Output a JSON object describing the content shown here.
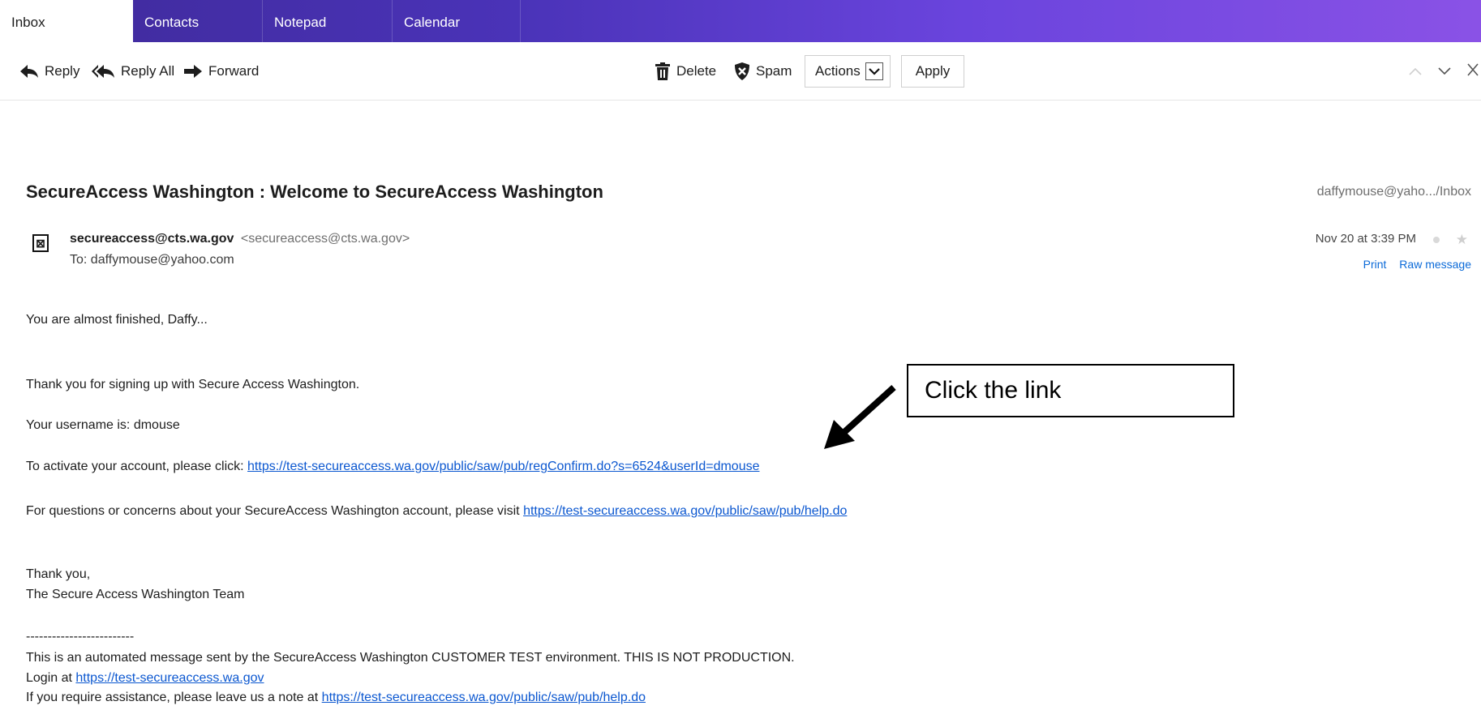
{
  "tabs": [
    {
      "label": "Inbox",
      "active": true
    },
    {
      "label": "Contacts",
      "active": false
    },
    {
      "label": "Notepad",
      "active": false
    },
    {
      "label": "Calendar",
      "active": false
    }
  ],
  "toolbar": {
    "reply_label": "Reply",
    "reply_all_label": "Reply All",
    "forward_label": "Forward",
    "delete_label": "Delete",
    "spam_label": "Spam",
    "actions_label": "Actions",
    "apply_label": "Apply"
  },
  "message": {
    "subject": "SecureAccess Washington : Welcome to SecureAccess Washington",
    "folder_path": "daffymouse@yaho.../Inbox",
    "avatar_glyph": "⊠",
    "sender_name": "secureaccess@cts.wa.gov",
    "sender_address": "<secureaccess@cts.wa.gov>",
    "to_line": "To: daffymouse@yahoo.com",
    "date": "Nov 20 at 3:39 PM",
    "star_glyph": "★",
    "print_label": "Print",
    "raw_label": "Raw message"
  },
  "body": {
    "greeting": "You are almost finished, Daffy...",
    "thanks_signup": "Thank you for signing up with Secure Access Washington.",
    "username_line": "Your username is: dmouse",
    "activate_prefix": "To activate your account, please click: ",
    "activate_link": "https://test-secureaccess.wa.gov/public/saw/pub/regConfirm.do?s=6524&userId=dmouse",
    "questions_prefix": "For questions or concerns about your SecureAccess Washington account, please visit ",
    "questions_link": "https://test-secureaccess.wa.gov/public/saw/pub/help.do",
    "closing": "Thank you,",
    "team": "The Secure Access Washington Team",
    "separator": "-------------------------",
    "automated": "This is an automated message sent by the SecureAccess Washington CUSTOMER TEST environment. THIS IS NOT PRODUCTION.",
    "login_prefix": "Login at ",
    "login_link": "https://test-secureaccess.wa.gov",
    "assist_prefix": "If you require assistance, please leave us a note at ",
    "assist_link": "https://test-secureaccess.wa.gov/public/saw/pub/help.do"
  },
  "annotation": {
    "callout_text": "Click the link"
  },
  "colors": {
    "tab_gradient_start": "#3f2a9a",
    "tab_gradient_end": "#8a52e6",
    "link": "#0b57d0",
    "action_link": "#0b6ad8"
  }
}
